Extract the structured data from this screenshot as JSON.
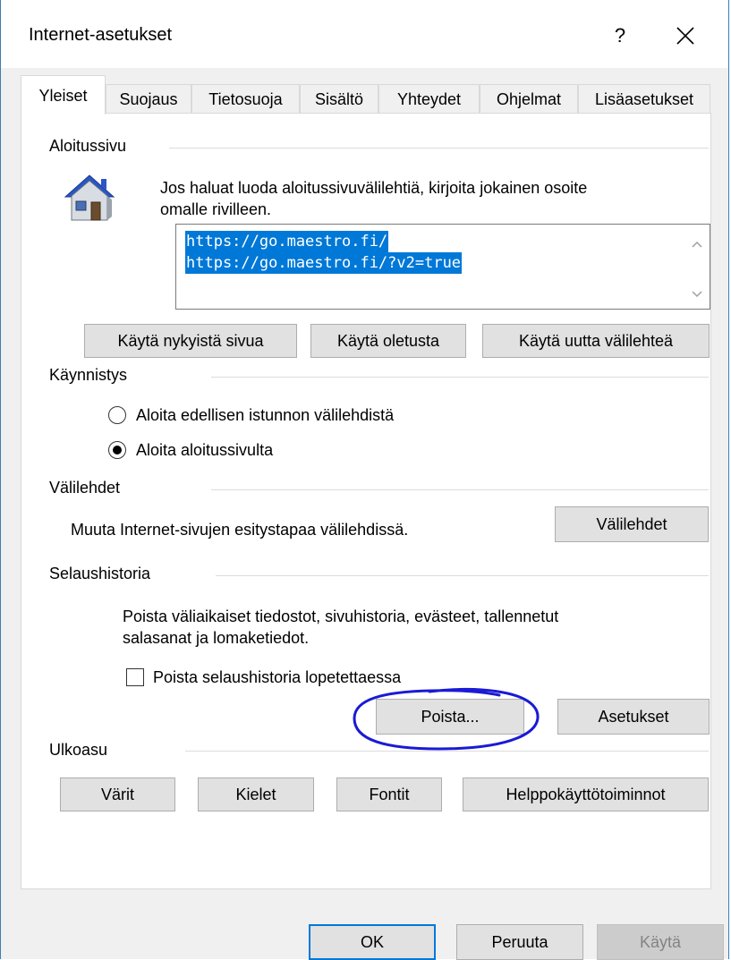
{
  "window": {
    "title": "Internet-asetukset",
    "help_label": "?",
    "close_icon": "close-icon"
  },
  "tabs": [
    {
      "label": "Yleiset",
      "active": true
    },
    {
      "label": "Suojaus",
      "active": false
    },
    {
      "label": "Tietosuoja",
      "active": false
    },
    {
      "label": "Sisältö",
      "active": false
    },
    {
      "label": "Yhteydet",
      "active": false
    },
    {
      "label": "Ohjelmat",
      "active": false
    },
    {
      "label": "Lisäasetukset",
      "active": false
    }
  ],
  "homepage": {
    "group_label": "Aloitussivu",
    "icon": "house-icon",
    "description_line1": "Jos haluat luoda aloitussivuvälilehtiä, kirjoita jokainen osoite",
    "description_line2": "omalle rivilleen.",
    "urls": [
      "https://go.maestro.fi/",
      "https://go.maestro.fi/?v2=true"
    ],
    "buttons": {
      "use_current": "Käytä nykyistä sivua",
      "use_default": "Käytä oletusta",
      "use_new_tab": "Käytä uutta välilehteä"
    }
  },
  "startup": {
    "group_label": "Käynnistys",
    "option_previous": "Aloita edellisen istunnon välilehdistä",
    "option_homepage": "Aloita aloitussivulta",
    "selected": "option_homepage"
  },
  "tabs_section": {
    "group_label": "Välilehdet",
    "description": "Muuta Internet-sivujen esitystapaa välilehdissä.",
    "button": "Välilehdet"
  },
  "history": {
    "group_label": "Selaushistoria",
    "description_line1": "Poista väliaikaiset tiedostot, sivuhistoria, evästeet, tallennetut",
    "description_line2": "salasanat ja lomaketiedot.",
    "checkbox_label": "Poista selaushistoria lopetettaessa",
    "checkbox_checked": false,
    "delete_button": "Poista...",
    "settings_button": "Asetukset",
    "annotation_color": "#1a1ad6"
  },
  "appearance": {
    "group_label": "Ulkoasu",
    "buttons": {
      "colors": "Värit",
      "languages": "Kielet",
      "fonts": "Fontit",
      "accessibility": "Helppokäyttötoiminnot"
    }
  },
  "footer": {
    "ok": "OK",
    "cancel": "Peruuta",
    "apply": "Käytä"
  },
  "colors": {
    "accent": "#0078d7",
    "button_face": "#e1e1e1",
    "dialog_bg": "#f0f0f0"
  }
}
